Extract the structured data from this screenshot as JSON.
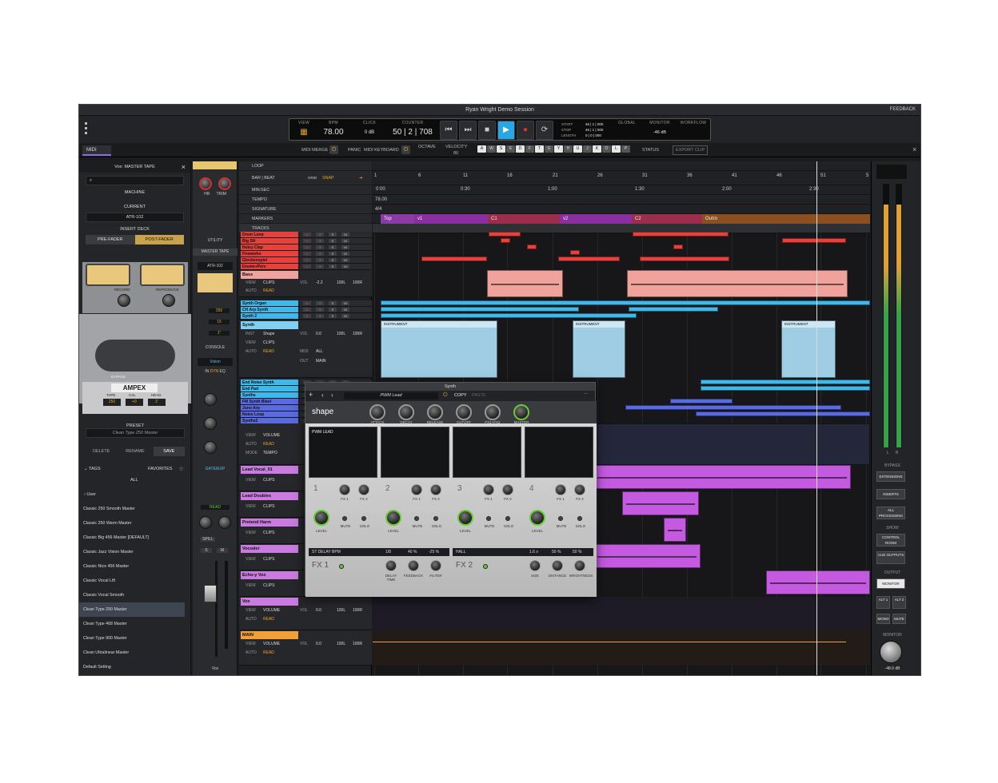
{
  "window": {
    "title": "Ryan Wright Demo Session",
    "feedback": "FEEDBACK"
  },
  "transport": {
    "view_label": "VIEW",
    "bpm_label": "BPM",
    "bpm": "78.00",
    "click_label": "CLICK",
    "click_val": "0 dB",
    "counter_label": "COUNTER",
    "counter": "50 | 2 | 708",
    "start_label": "START",
    "stop_label": "STOP",
    "length_label": "LENGTH",
    "start_val": "46 | 1 | 000",
    "stop_val": "46 | 1 | 000",
    "length_val": "0 | 0 | 000",
    "global_label": "GLOBAL",
    "monitor_label": "MONITOR",
    "monitor_val": "-46 dB",
    "workflow_label": "WORKFLOW"
  },
  "midi": {
    "tab": "MIDI",
    "midi_merge": "MIDI MERGE",
    "panic": "PANIC",
    "midi_keyboard": "MIDI KEYBOARD",
    "octave_label": "OCTAVE",
    "velocity_label": "VELOCITY",
    "velocity_val": "80",
    "keys": [
      "A",
      "W",
      "S",
      "E",
      "D",
      "F",
      "T",
      "G",
      "Y",
      "H",
      "U",
      "J",
      "K",
      "O",
      "L",
      "P"
    ],
    "status": "STATUS",
    "export_clip": "EXPORT CLIP"
  },
  "left": {
    "title": "Vox: MASTER TAPE",
    "machine": "MACHINE",
    "current": "CURRENT",
    "machine_val": "ATR-102",
    "insert_deck": "INSERT DECK",
    "pre_fader": "PRE-FADER",
    "post_fader": "POST-FADER",
    "record": "RECORD",
    "reproduce": "REPRODUCE",
    "brand": "AMPEX",
    "tape": "TAPE",
    "cal": "CAL",
    "head": "HEAD",
    "tape_val": "250",
    "cal_val": "+9",
    "head_val": "1\"",
    "bypass": "BYPASS",
    "preset_label": "PRESET",
    "preset_val": "Clean Type 250 Master",
    "delete": "DELETE",
    "rename": "RENAME",
    "save": "SAVE",
    "tags": "TAGS",
    "favorites": "FAVORITES",
    "all": "ALL",
    "user": "User",
    "presets": [
      "Classic 250 Smooth Master",
      "Classic 250 Warm Master",
      "Classic Big 456 Master [DEFAULT]",
      "Classic Jazz Vision Master",
      "Classic Nice 456 Master",
      "Classic Vocal Lift",
      "Classic Vocal Smooth",
      "Clean Type 250 Master",
      "Clean Type 468 Master",
      "Clean Type 900 Master",
      "Clean Ultralinear Master",
      "Default Setting"
    ],
    "selected_index": 7
  },
  "console": {
    "hr": "HR",
    "trim": "TRIM",
    "utility": "UTILITY",
    "master_tape": "MASTER TAPE",
    "atr": "ATR-102",
    "vals": [
      "250",
      "15",
      "1\""
    ],
    "console_label": "CONSOLE",
    "vision": "Vision",
    "in": "IN",
    "dyn": "DYN",
    "eq": "EQ",
    "gate_exp": "GATE/EXP",
    "read": "READ",
    "spill": "SPILL",
    "s": "S",
    "m": "M",
    "track_name": "Vox"
  },
  "headers": {
    "loop": "LOOP",
    "bar_beat": "BAR | BEAT",
    "grid": "GRID",
    "snap": "SNAP",
    "min_sec": "MIN:SEC",
    "tempo": "TEMPO",
    "tempo_val": "78.00",
    "signature": "SIGNATURE",
    "sig_val": "4/4",
    "markers": "MARKERS",
    "tracks": "TRACKS",
    "view": "VIEW",
    "clips": "CLIPS",
    "auto": "AUTO",
    "read": "READ",
    "vol": "VOL",
    "volume": "VOLUME",
    "inst": "INST",
    "shape": "Shape",
    "midi": "MIDI",
    "out": "OUT",
    "all": "ALL",
    "main": "MAIN",
    "mode": "MODE",
    "tempo_m": "TEMPO",
    "vol_val": "0.0",
    "pan_l": "100L",
    "pan_r": "100R",
    "bass_vol": "-2.2"
  },
  "tracks": [
    {
      "name": "Drum Loop",
      "color": "#e8403a"
    },
    {
      "name": "Big SN",
      "color": "#e8403a"
    },
    {
      "name": "Noisy Clap",
      "color": "#e8403a"
    },
    {
      "name": "Fireworks",
      "color": "#e8403a"
    },
    {
      "name": "Glockenspiel",
      "color": "#e8403a"
    },
    {
      "name": "Drums+Perc",
      "color": "#e8403a"
    }
  ],
  "tracks2": [
    {
      "name": "Synth Organ",
      "color": "#3fb8ec"
    },
    {
      "name": "CH Arp Synth",
      "color": "#3fb8ec"
    },
    {
      "name": "Synth 2",
      "color": "#3fb8ec"
    }
  ],
  "tracks3": [
    {
      "name": "End Noise Synth",
      "color": "#3fb8ec"
    },
    {
      "name": "End Pad",
      "color": "#3fb8ec"
    },
    {
      "name": "Synths",
      "color": "#3fb8ec"
    },
    {
      "name": "FM Synth Blast",
      "color": "#5a6ae0"
    },
    {
      "name": "Juno Arp",
      "color": "#5a6ae0"
    },
    {
      "name": "Noise Loop",
      "color": "#5a6ae0"
    },
    {
      "name": "Synths2",
      "color": "#5a6ae0"
    }
  ],
  "big_tracks": {
    "bass": "Bass",
    "synth": "Synth",
    "lead_vocal": "Lead Vocal_01",
    "lead_doubles": "Lead Doubles",
    "pretend_harm": "Pretend Harm",
    "vocoder": "Vocoder",
    "echo_vox": "Echo-y Vox",
    "vox": "Vox",
    "main": "MAIN"
  },
  "timeline": {
    "bars": [
      "1",
      "6",
      "11",
      "16",
      "21",
      "26",
      "31",
      "36",
      "41",
      "46",
      "51",
      "5"
    ],
    "times": [
      "0:00",
      "0:30",
      "1:00",
      "1:30",
      "2:00",
      "2:30"
    ],
    "tempo_val": "78.00",
    "sig_val": "4/4",
    "markers": [
      {
        "label": "Top",
        "color": "#8c3aa6"
      },
      {
        "label": "v1",
        "color": "#8a2fa0"
      },
      {
        "label": "C1",
        "color": "#9c2d4c"
      },
      {
        "label": "v2",
        "color": "#8a2fa0"
      },
      {
        "label": "C2",
        "color": "#9c2d4c"
      },
      {
        "label": "Outro",
        "color": "#8c5020"
      }
    ],
    "instrument": "INSTRUMENT",
    "q": "Q"
  },
  "plugin": {
    "title": "Synth",
    "preset": "PWM Lead",
    "copy": "COPY",
    "paste": "PASTE",
    "knobs": [
      "ATTACK",
      "DECAY",
      "RELEASE",
      "CUTOFF",
      "FX1+FX2",
      "MASTER"
    ],
    "brand": "shape",
    "slot1": "PWM LEAD",
    "voices": [
      "1",
      "2",
      "3",
      "4"
    ],
    "fx_labels": [
      "FX 1",
      "FX 2"
    ],
    "level": "LEVEL",
    "mute": "MUTE",
    "solo": "SOLO",
    "fx1_name": "ST DELAY BPM",
    "fx2_name": "HALL",
    "fx1_vals": [
      "1/8",
      "40 %",
      "-25 %"
    ],
    "fx2_vals": [
      "1.6 s",
      "50 %",
      "50 %"
    ],
    "fx1_knobs": [
      "DELAY TIME",
      "FEEDBACK",
      "FILTER"
    ],
    "fx2_knobs": [
      "SIZE",
      "DISTANCE",
      "BRIGHTNESS"
    ],
    "fx1": "FX 1",
    "fx2": "FX 2"
  },
  "right": {
    "l": "L",
    "r": "R",
    "bypass": "BYPASS",
    "extensions": "EXTENSIONS",
    "inserts": "INSERTS",
    "all_processing": "ALL PROCESSING",
    "show": "SHOW",
    "control_room": "CONTROL ROOM",
    "cue_outputs": "CUE OUTPUTS",
    "output": "OUTPUT",
    "monitor": "MONITOR",
    "alt1": "ALT 1",
    "alt2": "ALT 2",
    "mono": "MONO",
    "mute": "MUTE",
    "monitor_cap": "MONITOR",
    "monitor_db": "-48.0 dB"
  }
}
